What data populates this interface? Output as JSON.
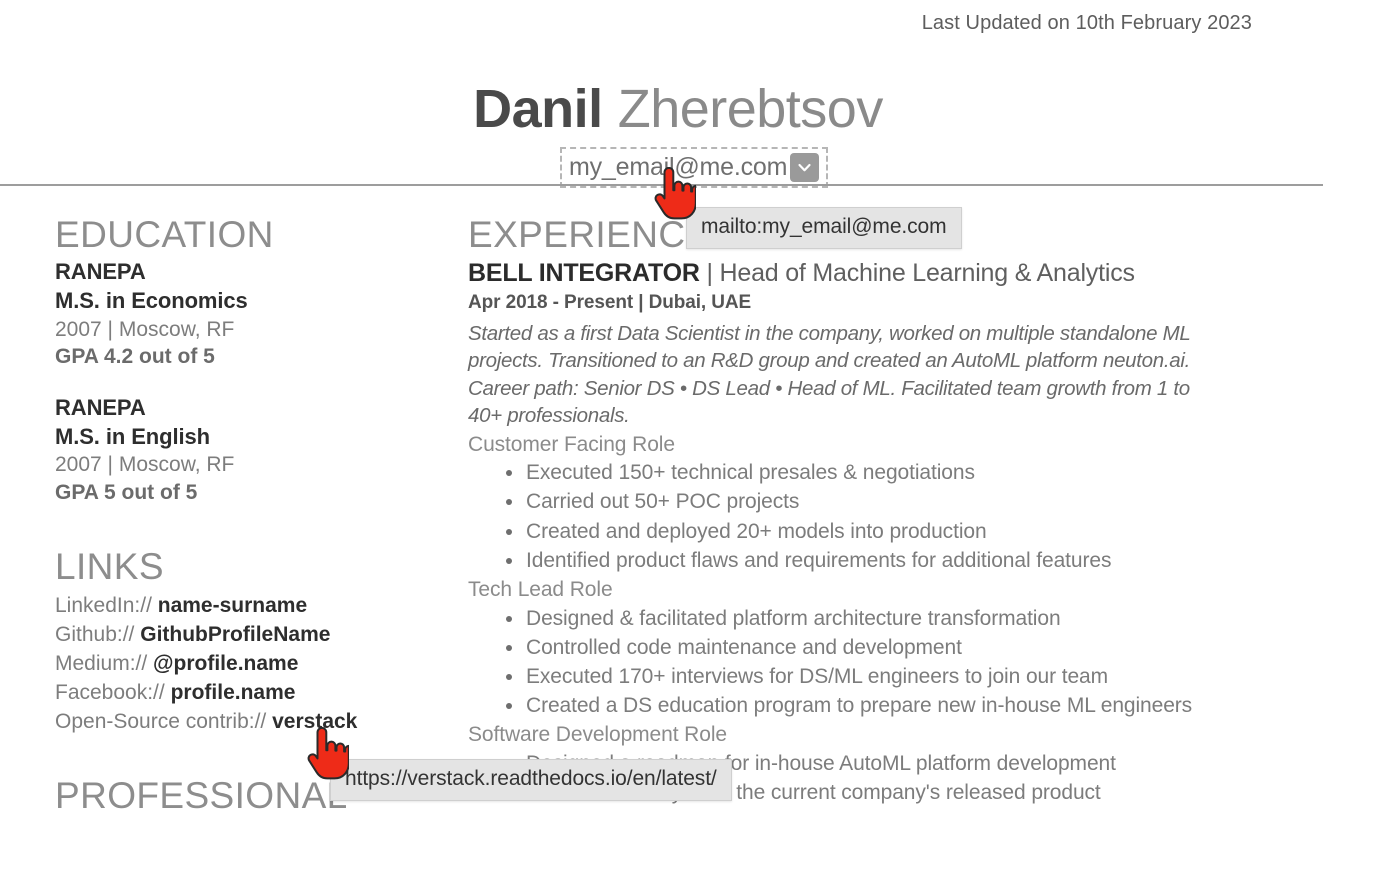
{
  "header": {
    "last_updated": "Last Updated on 10th February 2023",
    "name_first": "Danil",
    "name_last": "Zherebtsov",
    "email": "my_email@me.com",
    "dropdown_icon": "chevron-down-icon"
  },
  "tooltips": {
    "email": "mailto:my_email@me.com",
    "link": "https://verstack.readthedocs.io/en/latest/"
  },
  "education": {
    "title": "EDUCATION",
    "entries": [
      {
        "school": "RANEPA",
        "degree": "M.S. in Economics",
        "when": "2007 | Moscow, RF",
        "gpa": "GPA 4.2 out of 5"
      },
      {
        "school": "RANEPA",
        "degree": "M.S. in English",
        "when": "2007 | Moscow, RF",
        "gpa": "GPA 5 out of 5"
      }
    ]
  },
  "links": {
    "title": "LINKS",
    "items": [
      {
        "label": "LinkedIn://",
        "value": "name-surname"
      },
      {
        "label": "Github://",
        "value": "GithubProfileName"
      },
      {
        "label": "Medium://",
        "value": "@profile.name"
      },
      {
        "label": "Facebook://",
        "value": "profile.name"
      },
      {
        "label": "Open-Source contrib://",
        "value": "verstack"
      }
    ]
  },
  "professional": {
    "title": "PROFESSIONAL"
  },
  "experience": {
    "title": "EXPERIENCE",
    "company": "BELL INTEGRATOR",
    "role": " | Head of Machine Learning & Analytics",
    "meta": "Apr 2018 - Present | Dubai, UAE",
    "description": [
      "Started as a first Data Scientist in the company, worked on multiple standalone ML projects. Transitioned to an R&D group and created an AutoML platform neuton.ai.",
      "Career path: Senior DS • DS Lead • Head of ML. Facilitated team growth from 1 to 40+ professionals."
    ],
    "role_groups": [
      {
        "heading": "Customer Facing Role",
        "bullets": [
          "Executed 150+ technical presales & negotiations",
          "Carried out 50+ POC projects",
          "Created and deployed 20+ models into production",
          "Identified product flaws and requirements for additional features"
        ]
      },
      {
        "heading": "Tech Lead Role",
        "bullets": [
          "Designed & facilitated platform architecture transformation",
          "Controlled code maintenance and development",
          "Executed 170+ interviews for DS/ML engineers to join our team",
          "Created a DS education program to prepare new in-house ML engineers"
        ]
      },
      {
        "heading": "Software Development Role",
        "bullets": [
          "Designed a roadmap for in-house AutoML platform development",
          "Conducted analysis of the current company's released product"
        ]
      }
    ]
  },
  "colors": {
    "cursor_red": "#ee2b18",
    "tooltip_bg": "#e4e4e4",
    "rule": "#9d9d9d",
    "badge": "#9a9a9a"
  }
}
